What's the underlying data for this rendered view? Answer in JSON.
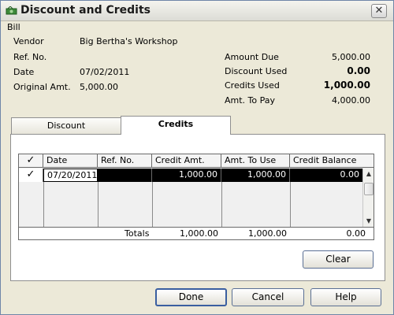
{
  "window": {
    "title": "Discount and Credits",
    "close_glyph": "✕"
  },
  "bill": {
    "section_label": "Bill",
    "vendor_label": "Vendor",
    "vendor_value": "Big Bertha's Workshop",
    "refno_label": "Ref. No.",
    "refno_value": "",
    "date_label": "Date",
    "date_value": "07/02/2011",
    "orig_label": "Original Amt.",
    "orig_value": "5,000.00",
    "amount_due_label": "Amount Due",
    "amount_due_value": "5,000.00",
    "discount_used_label": "Discount Used",
    "discount_used_value": "0.00",
    "credits_used_label": "Credits Used",
    "credits_used_value": "1,000.00",
    "amt_to_pay_label": "Amt. To Pay",
    "amt_to_pay_value": "4,000.00"
  },
  "tabs": [
    {
      "label": "Discount",
      "active": false
    },
    {
      "label": "Credits",
      "active": true
    }
  ],
  "grid": {
    "columns": [
      "✓",
      "Date",
      "Ref. No.",
      "Credit Amt.",
      "Amt. To Use",
      "Credit Balance"
    ],
    "rows": [
      {
        "check": "✓",
        "date": "07/20/2011",
        "ref": "",
        "credit_amt": "1,000.00",
        "amt_to_use": "1,000.00",
        "balance": "0.00"
      }
    ],
    "totals": {
      "label": "Totals",
      "credit_amt": "1,000.00",
      "amt_to_use": "1,000.00",
      "balance": "0.00"
    }
  },
  "buttons": {
    "clear": "Clear",
    "done": "Done",
    "cancel": "Cancel",
    "help": "Help"
  },
  "icons": {
    "title_icon": "money-icon",
    "scroll_up": "▲",
    "scroll_down": "▼"
  }
}
